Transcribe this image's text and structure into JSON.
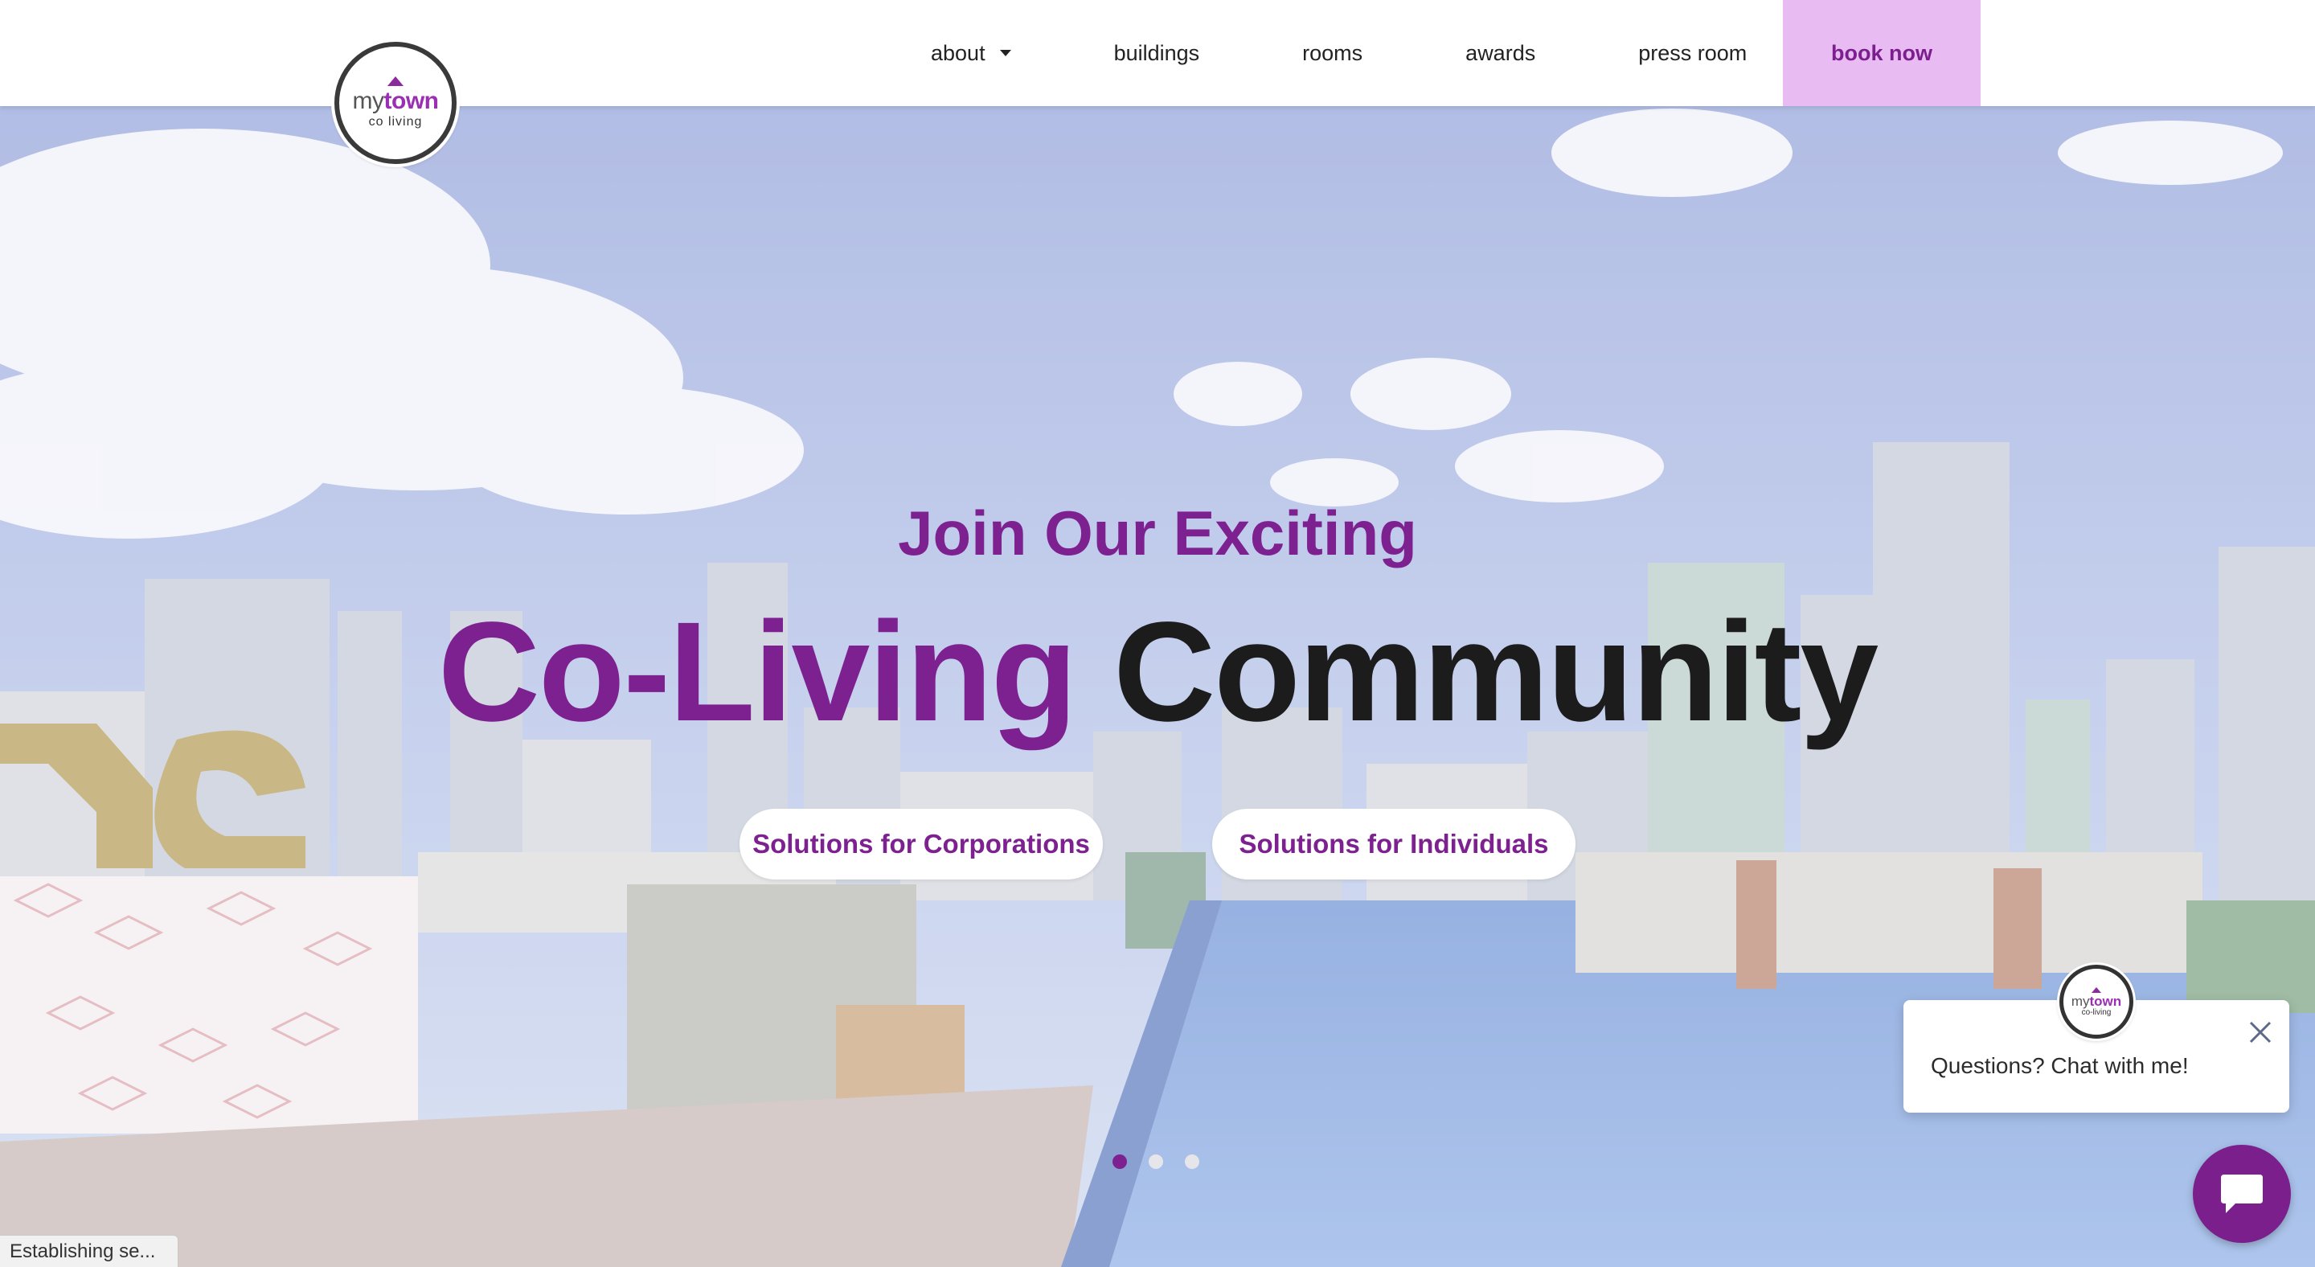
{
  "header": {
    "logo": {
      "brand_my": "my",
      "brand_town": "town",
      "sub": "co living"
    },
    "nav": [
      {
        "label": "about",
        "has_dropdown": true
      },
      {
        "label": "buildings"
      },
      {
        "label": "rooms"
      },
      {
        "label": "awards"
      },
      {
        "label": "press room"
      }
    ],
    "book_now": "book now"
  },
  "hero": {
    "kicker": "Join Our Exciting",
    "headline_part1": "Co-Living",
    "headline_part2": "Community",
    "cta_corporations": "Solutions for Corporations",
    "cta_individuals": "Solutions for Individuals",
    "carousel": {
      "slides": 3,
      "active": 1
    }
  },
  "chat": {
    "message": "Questions? Chat with me!",
    "avatar": {
      "brand_my": "my",
      "brand_town": "town",
      "sub": "co-living"
    },
    "launcher_icon": "chat-bubble-icon",
    "close_icon": "close-icon"
  },
  "status_bar": {
    "text": "Establishing se..."
  },
  "colors": {
    "brand_purple": "#7d2090",
    "book_now_bg": "#e9bbf3",
    "headline_dark": "#1c1c1c",
    "chat_launcher": "#7a1f8c"
  }
}
